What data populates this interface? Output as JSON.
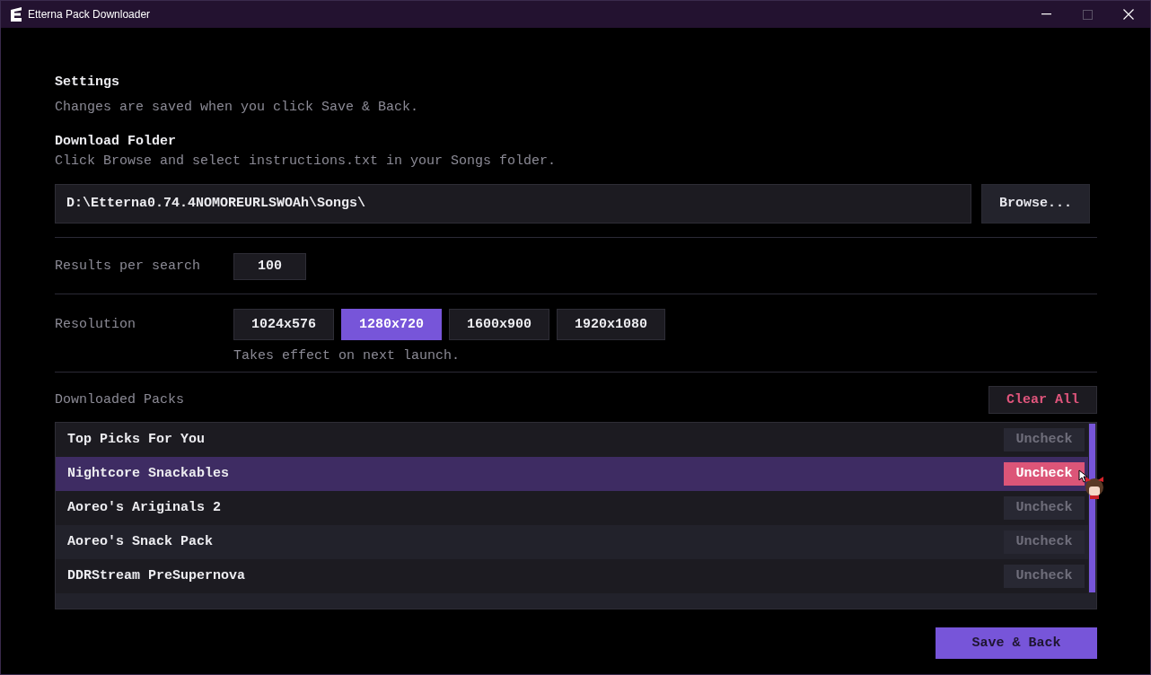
{
  "window": {
    "title": "Etterna Pack Downloader",
    "controls": [
      {
        "kind": "minimize",
        "disabled": false
      },
      {
        "kind": "maximize",
        "disabled": true
      },
      {
        "kind": "close",
        "disabled": false
      }
    ]
  },
  "settings": {
    "heading": "Settings",
    "note": "Changes are saved when you click Save & Back."
  },
  "download_folder": {
    "label": "Download Folder",
    "hint": "Click Browse and select instructions.txt in your Songs folder.",
    "path": "D:\\Etterna0.74.4NOMOREURLSWOAh\\Songs\\",
    "browse_button": "Browse..."
  },
  "results_per_search": {
    "label": "Results per search",
    "value": "100"
  },
  "resolution": {
    "label": "Resolution",
    "options": [
      {
        "label": "1024x576",
        "selected": false
      },
      {
        "label": "1280x720",
        "selected": true
      },
      {
        "label": "1600x900",
        "selected": false
      },
      {
        "label": "1920x1080",
        "selected": false
      }
    ],
    "note": "Takes effect on next launch."
  },
  "downloaded_packs": {
    "label": "Downloaded Packs",
    "clear_button": "Clear All",
    "rows": [
      {
        "name": "Top Picks For You",
        "button": "Uncheck",
        "selected": false
      },
      {
        "name": "Nightcore Snackables",
        "button": "Uncheck",
        "selected": true
      },
      {
        "name": "Aoreo's Ariginals 2",
        "button": "Uncheck",
        "selected": false
      },
      {
        "name": "Aoreo's Snack Pack",
        "button": "Uncheck",
        "selected": false
      },
      {
        "name": "DDRStream PreSupernova",
        "button": "Uncheck",
        "selected": false
      }
    ]
  },
  "save_button": "Save & Back"
}
